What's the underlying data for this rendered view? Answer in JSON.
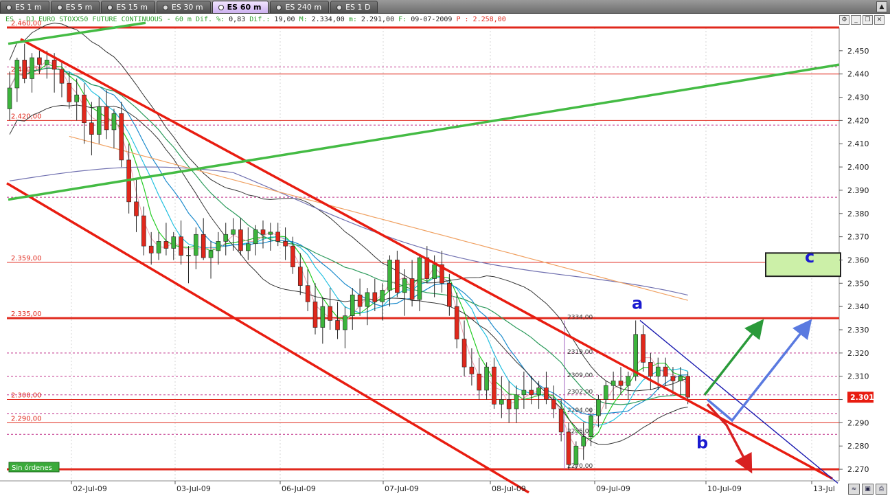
{
  "tabs": [
    {
      "label": "ES 1 m",
      "active": false
    },
    {
      "label": "ES 5 m",
      "active": false
    },
    {
      "label": "ES 15 m",
      "active": false
    },
    {
      "label": "ES 30 m",
      "active": false
    },
    {
      "label": "ES 60 m",
      "active": true
    },
    {
      "label": "ES 240 m",
      "active": false
    },
    {
      "label": "ES 1 D",
      "active": false
    }
  ],
  "infobar": {
    "symbol": "ES - DJ EURO STOXX50 FUTURE CONTINUOUS -  60 m",
    "pct_label": "Dif. %:",
    "pct": "0,83",
    "dif_label": "Dif.:",
    "dif": "19,00",
    "max_label": "M:",
    "max": "2.334,00",
    "min_label": "m:",
    "min": "2.291,00",
    "date_label": "F:",
    "date": "09-07-2009",
    "p_label": "P :",
    "p": "2.258,00"
  },
  "status_box": "Sin órdenes",
  "current_price_label": "2.301",
  "colors": {
    "red": "#e0281c",
    "green": "#3cb43c",
    "blue": "#1a1ad0",
    "channel": "#e81c10",
    "price_box": "#e81c10",
    "target_box": "#ccf0a8"
  },
  "chart_data": {
    "type": "candlestick",
    "ylim": [
      2265,
      2460
    ],
    "y_ticks": [
      2270,
      2280,
      2290,
      2300,
      2310,
      2320,
      2330,
      2340,
      2350,
      2360,
      2370,
      2380,
      2390,
      2400,
      2410,
      2420,
      2430,
      2440,
      2450
    ],
    "y_tick_labels": [
      "2.270",
      "2.280",
      "2.290",
      "2.300",
      "2.310",
      "2.320",
      "2.330",
      "2.340",
      "2.350",
      "2.360",
      "2.370",
      "2.380",
      "2.390",
      "2.400",
      "2.410",
      "2.420",
      "2.430",
      "2.440",
      "2.450"
    ],
    "x_labels": [
      "02-Jul-09",
      "03-Jul-09",
      "06-Jul-09",
      "07-Jul-09",
      "08-Jul-09",
      "09-Jul-09",
      "10-Jul-09",
      "13-Jul"
    ],
    "horizontal_levels": [
      {
        "value": 2460,
        "label": "2.460,00"
      },
      {
        "value": 2440,
        "label": "2.440,00"
      },
      {
        "value": 2420,
        "label": "2.420,00"
      },
      {
        "value": 2359,
        "label": "2.359,00"
      },
      {
        "value": 2335,
        "label": "2.335,00"
      },
      {
        "value": 2300,
        "label": "2.300,00"
      },
      {
        "value": 2290,
        "label": "2.290,00"
      },
      {
        "value": 2270,
        "label": ""
      }
    ],
    "dashed_levels": [
      2443,
      2418,
      2387,
      2320,
      2310,
      2302,
      2294,
      2285
    ],
    "fib_labels": [
      {
        "value": 2334,
        "label": "2334,00"
      },
      {
        "value": 2319,
        "label": "2319,00"
      },
      {
        "value": 2309,
        "label": "2309,00"
      },
      {
        "value": 2302,
        "label": "2302,00"
      },
      {
        "value": 2294,
        "label": "2294,00"
      },
      {
        "value": 2285,
        "label": "2285,00"
      },
      {
        "value": 2270,
        "label": "2270,00"
      }
    ],
    "annotations": [
      "a",
      "b",
      "c"
    ],
    "last_price": 2301,
    "candles": [
      [
        2425,
        2441,
        2420,
        2434
      ],
      [
        2434,
        2447,
        2428,
        2446
      ],
      [
        2446,
        2453,
        2436,
        2438
      ],
      [
        2438,
        2449,
        2432,
        2447
      ],
      [
        2447,
        2450,
        2440,
        2444
      ],
      [
        2444,
        2450,
        2438,
        2446
      ],
      [
        2446,
        2449,
        2432,
        2442
      ],
      [
        2442,
        2446,
        2430,
        2436
      ],
      [
        2436,
        2441,
        2425,
        2428
      ],
      [
        2428,
        2438,
        2420,
        2431
      ],
      [
        2431,
        2436,
        2410,
        2419
      ],
      [
        2419,
        2428,
        2405,
        2414
      ],
      [
        2414,
        2430,
        2410,
        2426
      ],
      [
        2426,
        2433,
        2412,
        2416
      ],
      [
        2416,
        2425,
        2408,
        2423
      ],
      [
        2423,
        2428,
        2400,
        2403
      ],
      [
        2403,
        2410,
        2380,
        2385
      ],
      [
        2385,
        2395,
        2372,
        2379
      ],
      [
        2379,
        2383,
        2362,
        2366
      ],
      [
        2366,
        2372,
        2358,
        2363
      ],
      [
        2363,
        2372,
        2360,
        2368
      ],
      [
        2368,
        2376,
        2362,
        2365
      ],
      [
        2365,
        2372,
        2360,
        2370
      ],
      [
        2370,
        2377,
        2358,
        2362
      ],
      [
        2362,
        2366,
        2350,
        2362
      ],
      [
        2362,
        2374,
        2356,
        2371
      ],
      [
        2371,
        2378,
        2360,
        2361
      ],
      [
        2361,
        2368,
        2352,
        2364
      ],
      [
        2364,
        2372,
        2358,
        2368
      ],
      [
        2368,
        2376,
        2362,
        2371
      ],
      [
        2371,
        2378,
        2364,
        2373
      ],
      [
        2373,
        2378,
        2362,
        2364
      ],
      [
        2364,
        2374,
        2360,
        2367
      ],
      [
        2367,
        2375,
        2362,
        2373
      ],
      [
        2373,
        2377,
        2365,
        2371
      ],
      [
        2371,
        2376,
        2364,
        2372
      ],
      [
        2372,
        2376,
        2366,
        2368
      ],
      [
        2368,
        2374,
        2360,
        2366
      ],
      [
        2366,
        2370,
        2354,
        2357
      ],
      [
        2357,
        2363,
        2345,
        2349
      ],
      [
        2349,
        2356,
        2338,
        2342
      ],
      [
        2342,
        2350,
        2328,
        2331
      ],
      [
        2331,
        2344,
        2324,
        2340
      ],
      [
        2340,
        2348,
        2330,
        2334
      ],
      [
        2334,
        2342,
        2326,
        2330
      ],
      [
        2330,
        2340,
        2322,
        2336
      ],
      [
        2336,
        2348,
        2330,
        2345
      ],
      [
        2345,
        2352,
        2336,
        2340
      ],
      [
        2340,
        2348,
        2332,
        2346
      ],
      [
        2346,
        2352,
        2338,
        2342
      ],
      [
        2342,
        2350,
        2334,
        2347
      ],
      [
        2347,
        2362,
        2340,
        2360
      ],
      [
        2360,
        2364,
        2344,
        2346
      ],
      [
        2346,
        2356,
        2336,
        2352
      ],
      [
        2352,
        2360,
        2340,
        2343
      ],
      [
        2343,
        2362,
        2338,
        2361
      ],
      [
        2361,
        2366,
        2350,
        2352
      ],
      [
        2352,
        2362,
        2344,
        2358
      ],
      [
        2358,
        2364,
        2346,
        2350
      ],
      [
        2350,
        2354,
        2336,
        2340
      ],
      [
        2340,
        2346,
        2322,
        2326
      ],
      [
        2326,
        2334,
        2310,
        2314
      ],
      [
        2314,
        2322,
        2306,
        2311
      ],
      [
        2311,
        2318,
        2300,
        2304
      ],
      [
        2304,
        2316,
        2300,
        2314
      ],
      [
        2314,
        2318,
        2296,
        2298
      ],
      [
        2298,
        2310,
        2292,
        2300
      ],
      [
        2300,
        2308,
        2290,
        2296
      ],
      [
        2296,
        2306,
        2290,
        2302
      ],
      [
        2302,
        2312,
        2296,
        2304
      ],
      [
        2304,
        2310,
        2298,
        2302
      ],
      [
        2302,
        2308,
        2296,
        2305
      ],
      [
        2305,
        2312,
        2298,
        2300
      ],
      [
        2300,
        2306,
        2292,
        2296
      ],
      [
        2296,
        2300,
        2282,
        2286
      ],
      [
        2286,
        2290,
        2270,
        2272
      ],
      [
        2272,
        2282,
        2270,
        2280
      ],
      [
        2280,
        2290,
        2274,
        2284
      ],
      [
        2284,
        2296,
        2280,
        2293
      ],
      [
        2293,
        2302,
        2288,
        2300
      ],
      [
        2300,
        2308,
        2296,
        2306
      ],
      [
        2306,
        2312,
        2300,
        2308
      ],
      [
        2308,
        2314,
        2302,
        2306
      ],
      [
        2306,
        2312,
        2300,
        2310
      ],
      [
        2310,
        2334,
        2308,
        2328
      ],
      [
        2328,
        2332,
        2312,
        2316
      ],
      [
        2316,
        2320,
        2304,
        2310
      ],
      [
        2310,
        2318,
        2304,
        2314
      ],
      [
        2314,
        2318,
        2306,
        2310
      ],
      [
        2310,
        2314,
        2302,
        2308
      ],
      [
        2308,
        2314,
        2302,
        2310
      ],
      [
        2310,
        2312,
        2298,
        2301
      ]
    ]
  }
}
